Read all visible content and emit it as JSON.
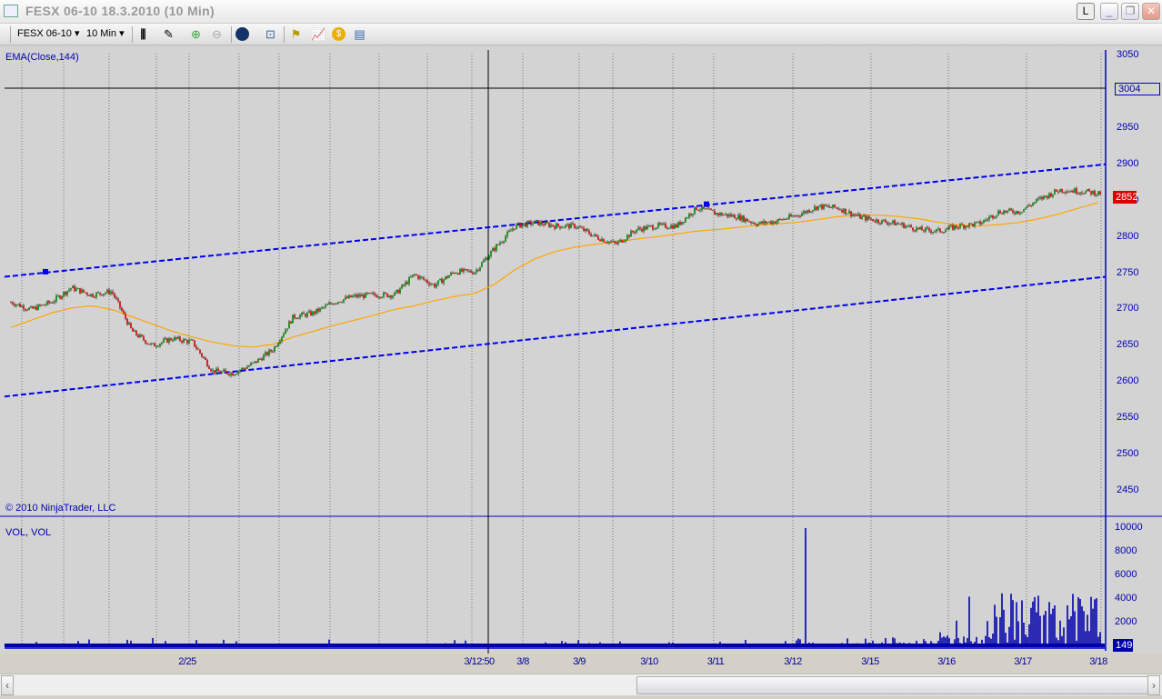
{
  "window": {
    "title": "FESX 06-10  18.3.2010 (10 Min)",
    "buttons": {
      "link": "L",
      "minimize": "_",
      "restore": "❐",
      "close": "✕"
    }
  },
  "toolbar": {
    "instrument": "FESX 06-10",
    "interval": "10 Min",
    "dropdown": "▾"
  },
  "price_panel": {
    "indicator_label": "EMA(Close,144)",
    "copyright": "© 2010 NinjaTrader, LLC",
    "crosshair_price": "3004",
    "last_price": "2852",
    "axis": [
      "3050",
      "2950",
      "2900",
      "2850",
      "2800",
      "2750",
      "2700",
      "2650",
      "2600",
      "2550",
      "2500",
      "2450"
    ]
  },
  "volume_panel": {
    "label": "VOL, VOL",
    "last_volume": "149",
    "axis": [
      "10000",
      "8000",
      "6000",
      "4000",
      "2000"
    ]
  },
  "time_axis": [
    "2/25",
    "3/12:50",
    "3/8",
    "3/9",
    "3/10",
    "3/11",
    "3/12",
    "3/15",
    "3/16",
    "3/17",
    "3/18"
  ],
  "colors": {
    "axis": "#0000cc",
    "ema": "#ffa500",
    "up": "#008000",
    "down": "#cc0000",
    "channel": "#0000ee",
    "volume": "#0000aa",
    "last_price": "#dd0000"
  },
  "chart_data": {
    "type": "candlestick",
    "instrument": "FESX 06-10",
    "interval": "10 Min",
    "ylim": [
      2420,
      3060
    ],
    "close_samples": [
      2710,
      2700,
      2710,
      2730,
      2720,
      2725,
      2670,
      2650,
      2660,
      2655,
      2615,
      2612,
      2625,
      2645,
      2690,
      2695,
      2710,
      2718,
      2720,
      2720,
      2748,
      2733,
      2752,
      2752,
      2785,
      2815,
      2820,
      2815,
      2815,
      2800,
      2790,
      2810,
      2815,
      2815,
      2840,
      2832,
      2828,
      2818,
      2822,
      2830,
      2842,
      2840,
      2828,
      2822,
      2818,
      2810,
      2808,
      2815,
      2818,
      2835,
      2835,
      2852,
      2865,
      2863,
      2860
    ],
    "ema_samples": [
      2675,
      2685,
      2695,
      2702,
      2705,
      2700,
      2690,
      2680,
      2670,
      2662,
      2655,
      2650,
      2648,
      2652,
      2662,
      2670,
      2678,
      2685,
      2692,
      2700,
      2705,
      2712,
      2718,
      2722,
      2735,
      2755,
      2770,
      2780,
      2786,
      2790,
      2793,
      2797,
      2800,
      2804,
      2808,
      2810,
      2813,
      2816,
      2818,
      2820,
      2824,
      2828,
      2830,
      2830,
      2828,
      2825,
      2820,
      2816,
      2815,
      2817,
      2820,
      2825,
      2832,
      2840,
      2848
    ],
    "channel_upper": [
      2745,
      2900
    ],
    "channel_lower": [
      2580,
      2745
    ],
    "volume_ylim": [
      0,
      10500
    ],
    "volume_spikes": [
      [
        0.13,
        700
      ],
      [
        0.73,
        10000
      ],
      [
        0.88,
        4200
      ],
      [
        0.93,
        2000
      ],
      [
        0.95,
        3000
      ],
      [
        1.0,
        1200
      ]
    ]
  }
}
